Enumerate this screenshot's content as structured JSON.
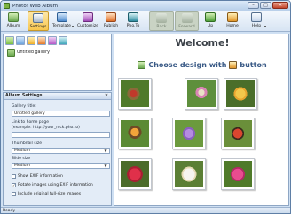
{
  "window": {
    "title": "Photo! Web Album"
  },
  "toolbar": {
    "buttons": [
      {
        "label": "Album"
      },
      {
        "label": "Settings"
      },
      {
        "label": "Template"
      },
      {
        "label": "Customize"
      },
      {
        "label": "Publish"
      },
      {
        "label": "Pho.To"
      },
      {
        "label": "Back"
      },
      {
        "label": "Forward"
      },
      {
        "label": "Up"
      },
      {
        "label": "Home"
      },
      {
        "label": "Help"
      }
    ]
  },
  "gallery_tree": {
    "item": "Untitled gallery"
  },
  "album_settings": {
    "title": "Album Settings",
    "gallery_title_label": "Gallery title:",
    "gallery_title_value": "Untitled gallery",
    "link_label": "Link to home page",
    "link_example": "(example: http://your_nick.pho.to)",
    "link_value": "",
    "thumb_size_label": "Thumbnail size",
    "thumb_size_value": "Medium",
    "slide_size_label": "Slide size",
    "slide_size_value": "Medium",
    "chk_show_exif": "Show EXIF information",
    "chk_rotate": "Rotate images using EXIF information",
    "chk_include": "Include original full-size images"
  },
  "main": {
    "welcome": "Welcome!",
    "choose_prefix": "Choose design with",
    "choose_suffix": "button"
  },
  "status": {
    "text": "Ready"
  },
  "colors": {
    "accent": "#3a5a86",
    "active_button": "#f7c64d",
    "window_frame": "#5f7fa6"
  }
}
